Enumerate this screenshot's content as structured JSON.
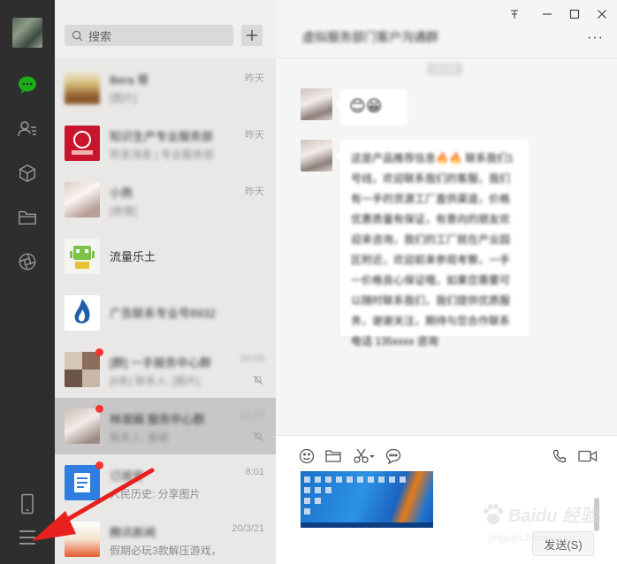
{
  "window_controls": {
    "pin": "⊤",
    "minimize": "—",
    "maximize": "□",
    "close": "✕"
  },
  "search": {
    "placeholder": "搜索"
  },
  "conversations": [
    {
      "name": "Bera 哥",
      "preview": "[图片]",
      "time": "昨天"
    },
    {
      "name": "知识生产专业服务部",
      "preview": "转发消息 | 专业服务部",
      "time": "昨天"
    },
    {
      "name": "小燕",
      "preview": "[表情]",
      "time": "昨天"
    },
    {
      "name": "流量乐土",
      "preview": "",
      "time": ""
    },
    {
      "name": "广告联系专业号8932",
      "preview": "",
      "time": ""
    },
    {
      "name": "[群] 一手服务中心群",
      "preview": "[6条] 联系人: [图片]",
      "time": "16:09"
    },
    {
      "name": "林淑娟 服务中心群",
      "preview": "联系人: 谢谢",
      "time": "10:07"
    },
    {
      "name": "订阅号",
      "preview": "人民历史: 分享图片",
      "time": "8:01"
    },
    {
      "name": "腾讯新闻",
      "preview": "假期必玩3款解压游戏，",
      "time": "20/3/21"
    }
  ],
  "chat": {
    "title": "虚拟服务部门客户沟通群",
    "more": "···",
    "time_chip": "10:26",
    "message1_emojis": "😊😁",
    "message2_text": "这是产品推荐信息🔥🔥 联系我们1号线，欢迎联系我们的客服，我们有一手的货源工厂直供渠道，价格优惠质量有保证，有意向的朋友欢迎来咨询，我们的工厂就在产业园区附近，欢迎前来参观考察，一手一价格良心保证哦，如果您需要可以随时联系我们，我们提供优质服务，谢谢关注，期待与您合作联系电话 135xxxx 咨询"
  },
  "input": {
    "send_label": "发送(S)"
  },
  "watermark": {
    "brand": "Baidu 经验",
    "url": "jingyan.baidu.com"
  },
  "colors": {
    "rail": "#2e2e2e",
    "list_bg": "#e9e8e7",
    "chat_bg": "#f5f5f5",
    "accent_green": "#1aad19",
    "badge_red": "#f43530",
    "annotation_red": "#e8201e"
  }
}
